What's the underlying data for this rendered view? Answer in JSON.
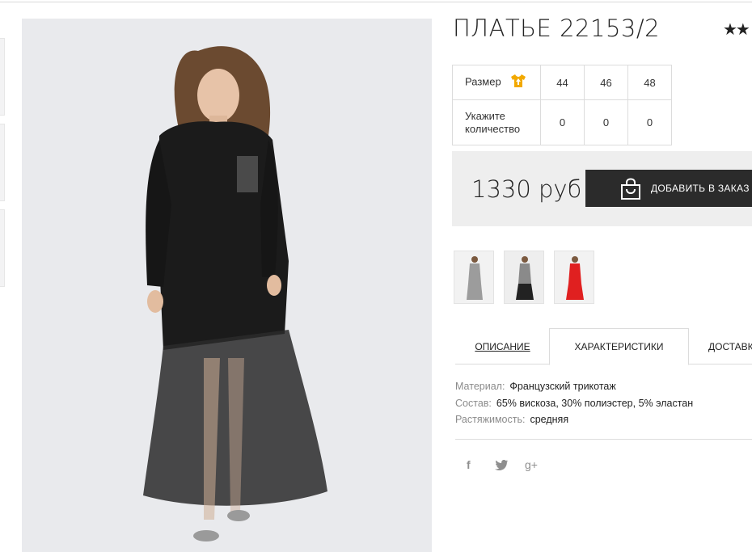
{
  "product": {
    "title": "ПЛАТЬЕ 22153/2",
    "rating_stars": "★★"
  },
  "sizes": {
    "size_label": "Размер",
    "size_icon": "tshirt-up-icon",
    "quantity_label_line1": "Укажите",
    "quantity_label_line2": "количество",
    "values": [
      "44",
      "46",
      "48"
    ],
    "quantities": [
      "0",
      "0",
      "0"
    ]
  },
  "price": {
    "value": "1330 руб",
    "add_button": "ДОБАВИТЬ В ЗАКАЗ"
  },
  "tabs": {
    "description": "ОПИСАНИЕ",
    "characteristics": "ХАРАКТЕРИСТИКИ",
    "delivery": "ДОСТАВКА"
  },
  "specs": [
    {
      "key": "Материал:",
      "value": "Французский трикотаж"
    },
    {
      "key": "Состав:",
      "value": "65% вискоза, 30% полиэстер, 5% эластан"
    },
    {
      "key": "Растяжимость:",
      "value": "средняя"
    }
  ],
  "social": {
    "facebook": "f",
    "twitter": "twitter-icon",
    "googleplus": "g+"
  },
  "colors": {
    "accent_icon": "#f2a900",
    "button_bg": "#2b2b2b",
    "variant_colors": [
      "grey",
      "grey-black",
      "red"
    ]
  }
}
